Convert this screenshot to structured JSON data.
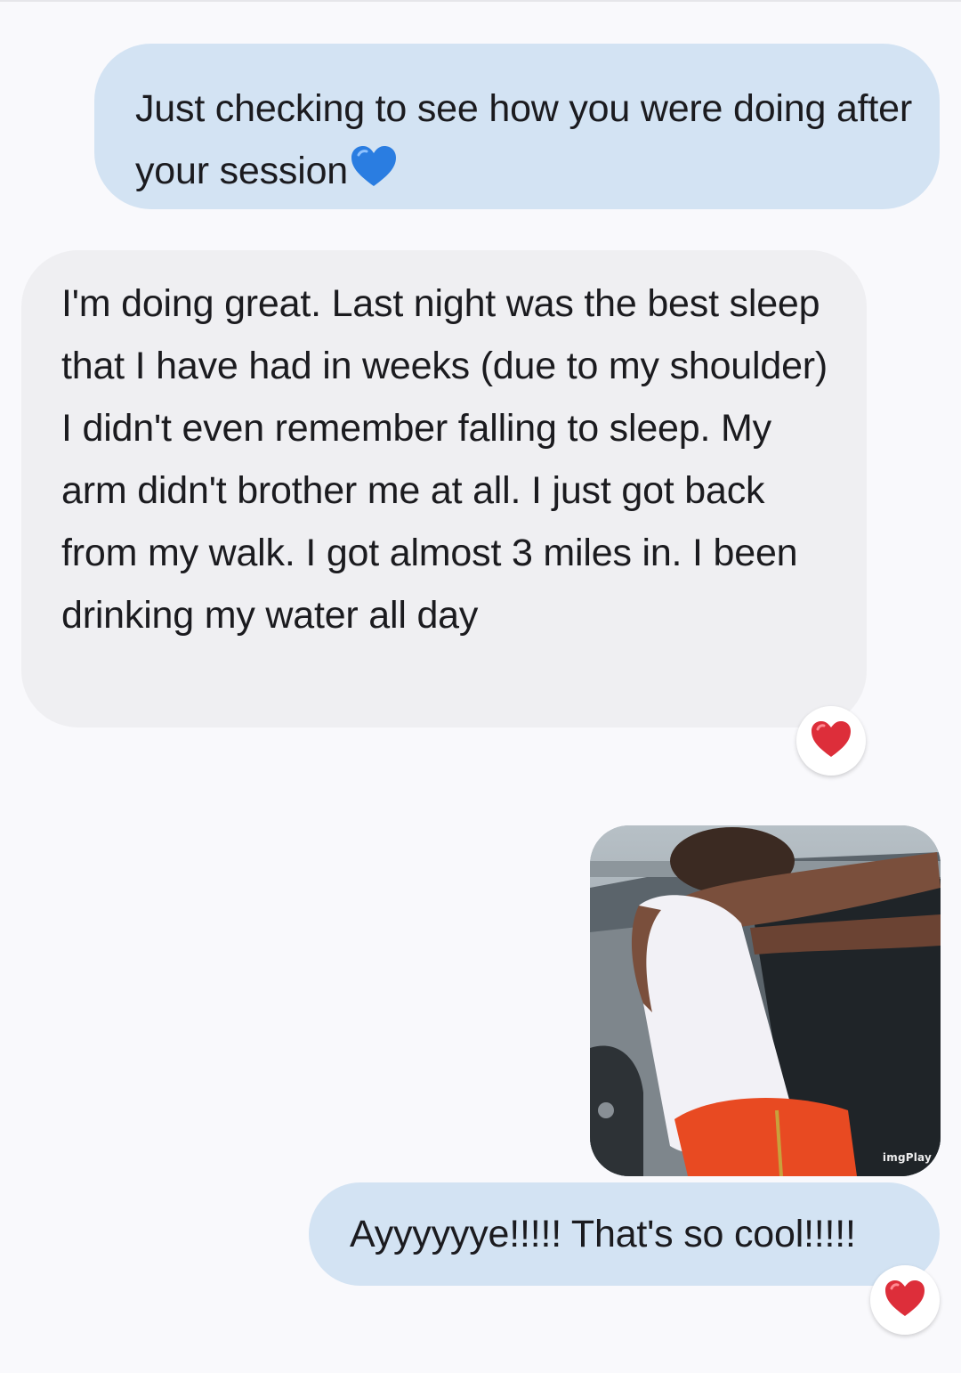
{
  "messages": [
    {
      "direction": "outgoing",
      "text": "Just checking to see how you were doing after your session",
      "emoji": "blue-heart"
    },
    {
      "direction": "incoming",
      "text": "I'm doing great. Last night was the best sleep that I have had in weeks (due to my shoulder) I didn't even remember falling to sleep. My arm didn't brother me at all. I just got back from my walk. I got almost 3 miles in. I been drinking my water all day",
      "reaction": "red-heart"
    },
    {
      "direction": "outgoing",
      "type": "gif",
      "watermark": "imgPlay"
    },
    {
      "direction": "outgoing",
      "text": "Ayyyyyye!!!!! That's so cool!!!!!",
      "reaction": "red-heart"
    }
  ],
  "colors": {
    "outgoing_bubble": "#d3e3f3",
    "incoming_bubble": "#efeff2",
    "background": "#f9f9fc",
    "blue_heart": "#2a7de1",
    "red_heart": "#dd2e3a"
  }
}
